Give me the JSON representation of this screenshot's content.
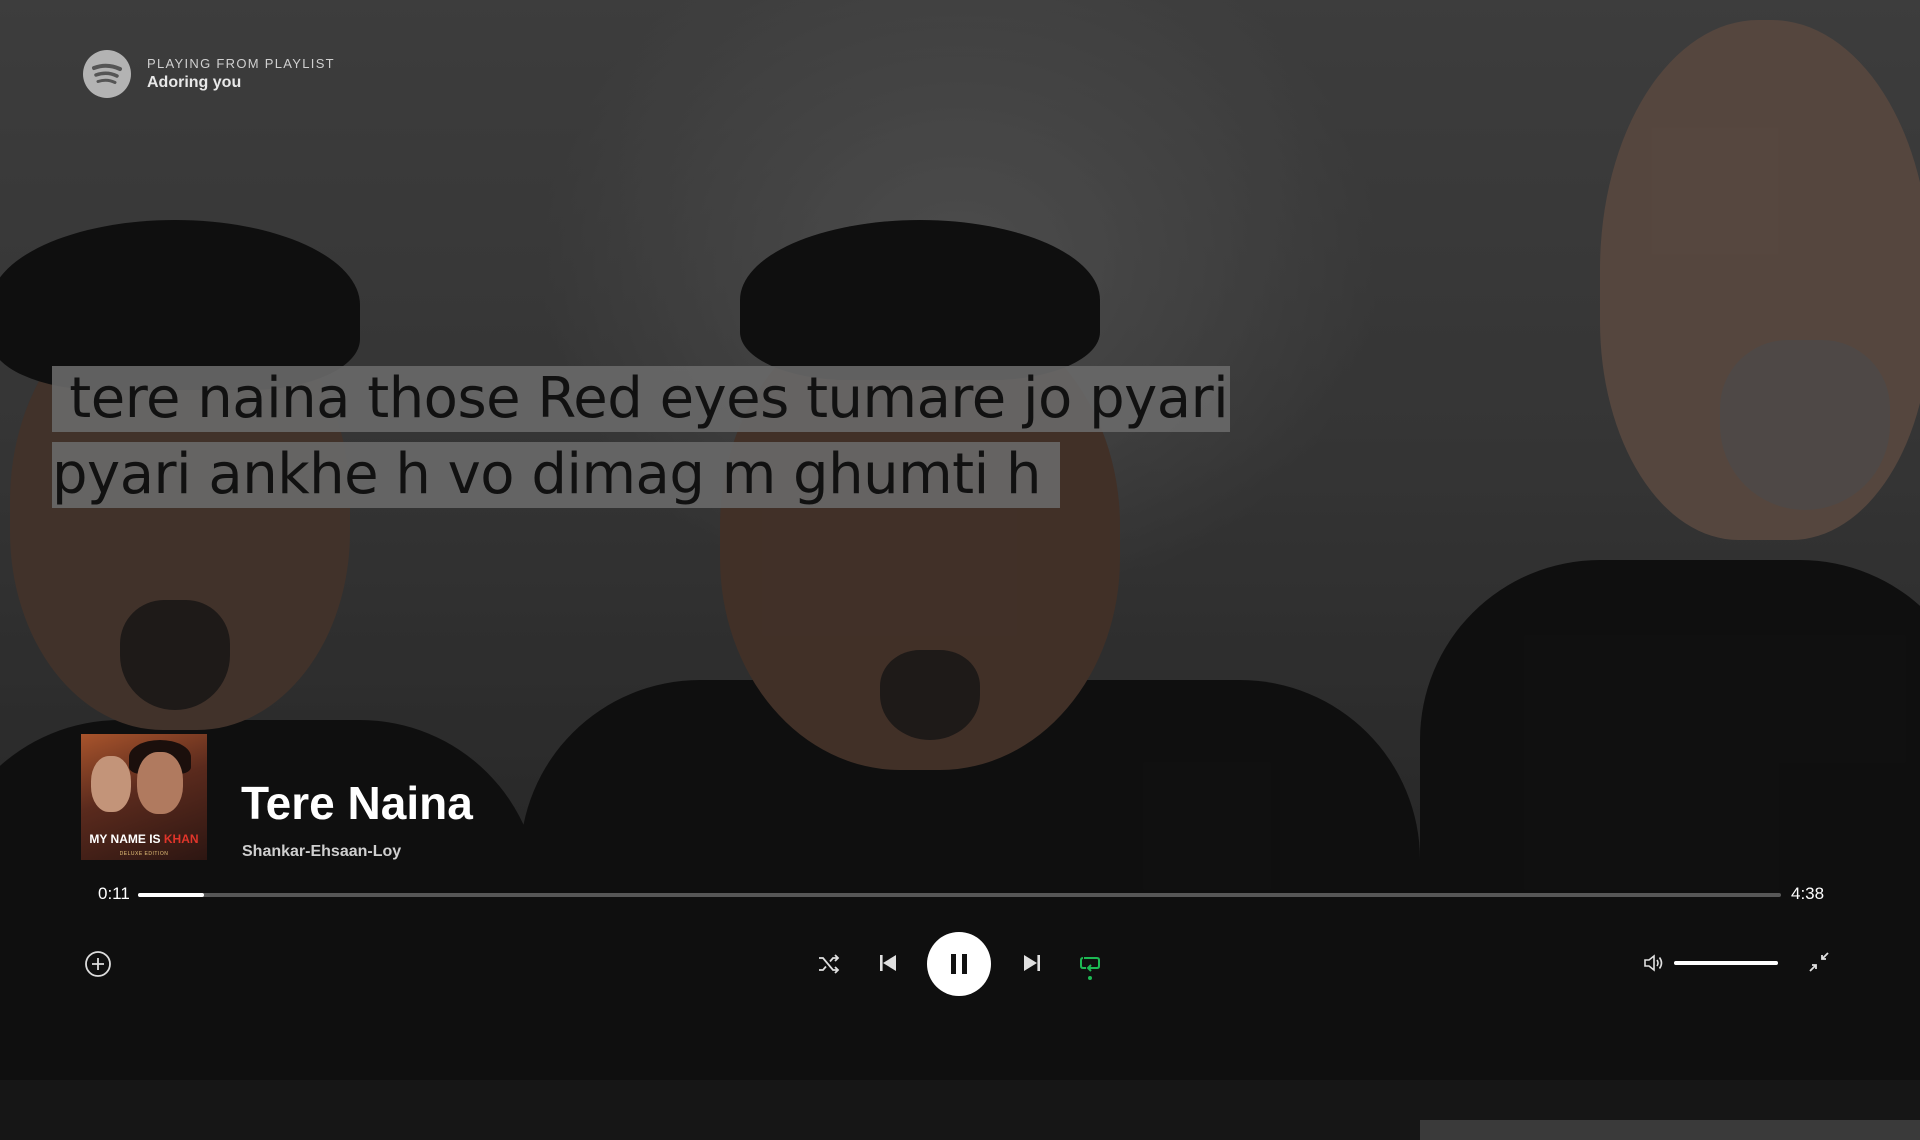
{
  "header": {
    "subtitle": "PLAYING FROM PLAYLIST",
    "playlist_name": "Adoring you"
  },
  "lyrics": {
    "lines": [
      " tere naina those Red eyes tumare jo pyari",
      "pyari ankhe h vo dimag m ghumti h "
    ]
  },
  "album_art": {
    "title_part1": "MY NAME IS ",
    "title_part2": "KHAN",
    "edition": "DELUXE EDITION"
  },
  "track": {
    "title": "Tere Naina",
    "artist": "Shankar-Ehsaan-Loy"
  },
  "playback": {
    "current_time": "0:11",
    "total_time": "4:38",
    "progress_fraction": 0.04,
    "volume_fraction": 1.0,
    "repeat_active": true
  },
  "icons": {
    "logo": "spotify-logo-icon",
    "add": "add-circle-icon",
    "shuffle": "shuffle-icon",
    "previous": "skip-previous-icon",
    "pause": "pause-icon",
    "next": "skip-next-icon",
    "repeat": "repeat-icon",
    "volume": "volume-icon",
    "exit_fullscreen": "minimize-fullscreen-icon"
  },
  "colors": {
    "accent": "#1db954",
    "lyric_highlight": "#696969",
    "text_primary": "#ffffff"
  }
}
